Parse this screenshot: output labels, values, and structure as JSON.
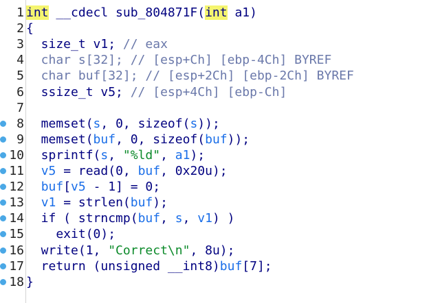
{
  "editor": {
    "lines": [
      {
        "n": "1",
        "bp": false,
        "tokens": [
          {
            "t": "int",
            "c": "kwhl"
          },
          {
            "t": " __cdecl sub_804871F(",
            "c": "txt"
          },
          {
            "t": "int",
            "c": "kwhl"
          },
          {
            "t": " a1)",
            "c": "txt"
          }
        ]
      },
      {
        "n": "2",
        "bp": false,
        "tokens": [
          {
            "t": "{",
            "c": "pn"
          }
        ]
      },
      {
        "n": "3",
        "bp": false,
        "tokens": [
          {
            "t": "  size_t v1; ",
            "c": "txt"
          },
          {
            "t": "// eax",
            "c": "cmt"
          }
        ]
      },
      {
        "n": "4",
        "bp": false,
        "tokens": [
          {
            "t": "  char s[32]; ",
            "c": "cmt"
          },
          {
            "t": "// [esp+Ch] [ebp-4Ch] BYREF",
            "c": "cmt"
          }
        ]
      },
      {
        "n": "5",
        "bp": false,
        "tokens": [
          {
            "t": "  char buf[32]; ",
            "c": "cmt"
          },
          {
            "t": "// [esp+2Ch] [ebp-2Ch] BYREF",
            "c": "cmt"
          }
        ]
      },
      {
        "n": "6",
        "bp": false,
        "tokens": [
          {
            "t": "  ssize_t v5; ",
            "c": "txt"
          },
          {
            "t": "// [esp+4Ch] [ebp-Ch]",
            "c": "cmt"
          }
        ]
      },
      {
        "n": "7",
        "bp": false,
        "tokens": []
      },
      {
        "n": "8",
        "bp": true,
        "tokens": [
          {
            "t": "  memset(",
            "c": "txt"
          },
          {
            "t": "s",
            "c": "var"
          },
          {
            "t": ", 0, sizeof(",
            "c": "txt"
          },
          {
            "t": "s",
            "c": "var"
          },
          {
            "t": "));",
            "c": "txt"
          }
        ]
      },
      {
        "n": "9",
        "bp": true,
        "tokens": [
          {
            "t": "  memset(",
            "c": "txt"
          },
          {
            "t": "buf",
            "c": "var"
          },
          {
            "t": ", 0, sizeof(",
            "c": "txt"
          },
          {
            "t": "buf",
            "c": "var"
          },
          {
            "t": "));",
            "c": "txt"
          }
        ]
      },
      {
        "n": "10",
        "bp": true,
        "tokens": [
          {
            "t": "  sprintf(",
            "c": "txt"
          },
          {
            "t": "s",
            "c": "var"
          },
          {
            "t": ", ",
            "c": "txt"
          },
          {
            "t": "\"%ld\"",
            "c": "str"
          },
          {
            "t": ", ",
            "c": "txt"
          },
          {
            "t": "a1",
            "c": "var"
          },
          {
            "t": ");",
            "c": "txt"
          }
        ]
      },
      {
        "n": "11",
        "bp": true,
        "tokens": [
          {
            "t": "  ",
            "c": "txt"
          },
          {
            "t": "v5",
            "c": "var"
          },
          {
            "t": " = read(0, ",
            "c": "txt"
          },
          {
            "t": "buf",
            "c": "var"
          },
          {
            "t": ", 0x20u);",
            "c": "txt"
          }
        ]
      },
      {
        "n": "12",
        "bp": true,
        "tokens": [
          {
            "t": "  ",
            "c": "txt"
          },
          {
            "t": "buf",
            "c": "var"
          },
          {
            "t": "[",
            "c": "txt"
          },
          {
            "t": "v5",
            "c": "var"
          },
          {
            "t": " - 1] = 0;",
            "c": "txt"
          }
        ]
      },
      {
        "n": "13",
        "bp": true,
        "tokens": [
          {
            "t": "  ",
            "c": "txt"
          },
          {
            "t": "v1",
            "c": "var"
          },
          {
            "t": " = strlen(",
            "c": "txt"
          },
          {
            "t": "buf",
            "c": "var"
          },
          {
            "t": ");",
            "c": "txt"
          }
        ]
      },
      {
        "n": "14",
        "bp": true,
        "tokens": [
          {
            "t": "  if ( strncmp(",
            "c": "txt"
          },
          {
            "t": "buf",
            "c": "var"
          },
          {
            "t": ", ",
            "c": "txt"
          },
          {
            "t": "s",
            "c": "var"
          },
          {
            "t": ", ",
            "c": "txt"
          },
          {
            "t": "v1",
            "c": "var"
          },
          {
            "t": ") )",
            "c": "txt"
          }
        ]
      },
      {
        "n": "15",
        "bp": true,
        "tokens": [
          {
            "t": "    exit(0);",
            "c": "txt"
          }
        ]
      },
      {
        "n": "16",
        "bp": true,
        "tokens": [
          {
            "t": "  write(1, ",
            "c": "txt"
          },
          {
            "t": "\"Correct\\n\"",
            "c": "str"
          },
          {
            "t": ", 8u);",
            "c": "txt"
          }
        ]
      },
      {
        "n": "17",
        "bp": true,
        "tokens": [
          {
            "t": "  return (unsigned __int8)",
            "c": "txt"
          },
          {
            "t": "buf",
            "c": "var"
          },
          {
            "t": "[7];",
            "c": "txt"
          }
        ]
      },
      {
        "n": "18",
        "bp": true,
        "tokens": [
          {
            "t": "}",
            "c": "pn"
          }
        ]
      }
    ]
  },
  "colors": {
    "keyword": "#000080",
    "keyword_highlight": "#f5f56f",
    "variable": "#1a6ee8",
    "comment": "#6a78aa",
    "string": "#0c8a2a",
    "breakpoint_dot": "#4aa8e6"
  }
}
